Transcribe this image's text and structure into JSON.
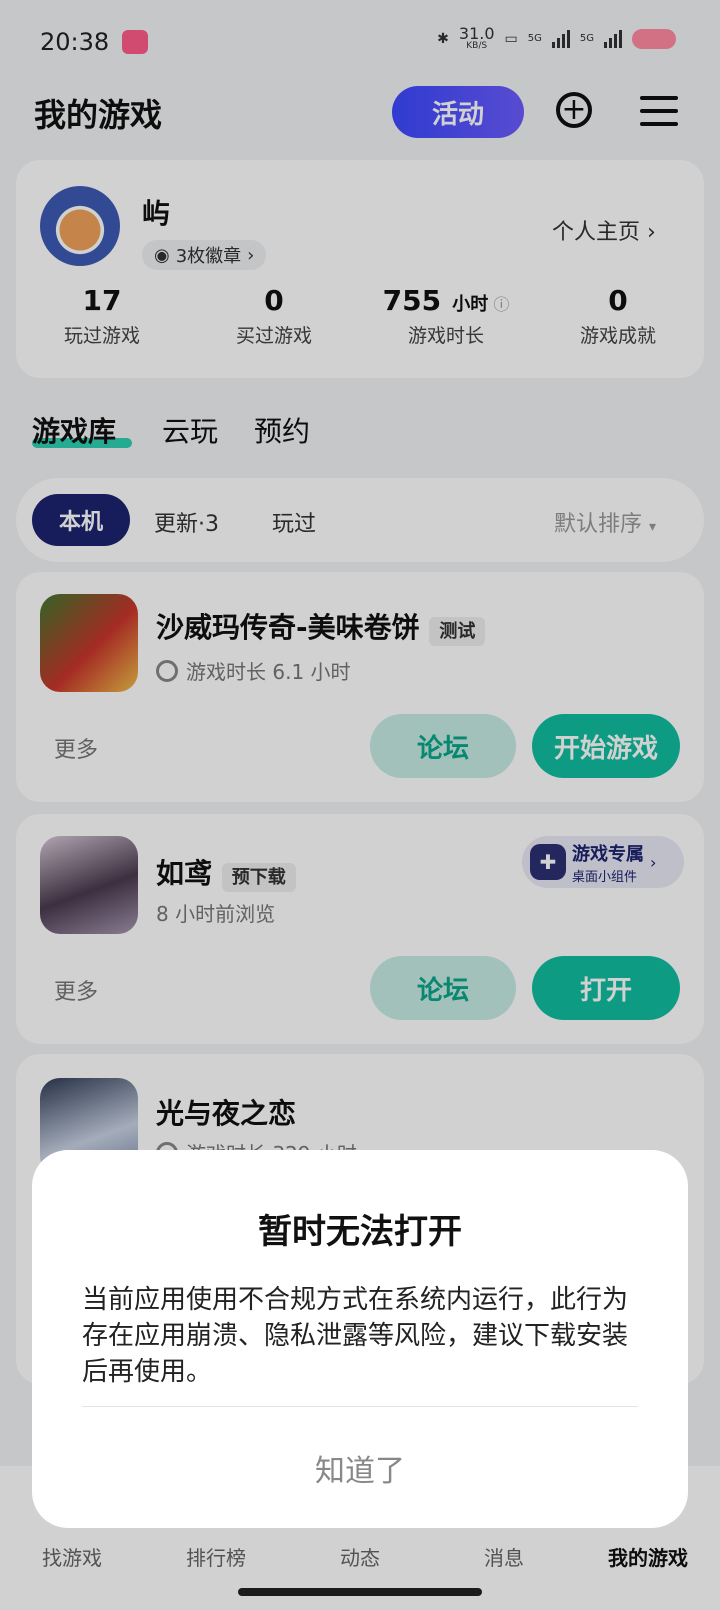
{
  "status_bar": {
    "time": "20:38",
    "net_speed": "31.0",
    "net_unit": "KB/S",
    "sim1_label": "5G",
    "sim2_label": "5G"
  },
  "header": {
    "title": "我的游戏",
    "activity_label": "活动"
  },
  "profile": {
    "name": "屿",
    "badges_label": "3枚徽章",
    "profile_link": "个人主页",
    "stats": [
      {
        "value": "17",
        "unit": "",
        "label": "玩过游戏"
      },
      {
        "value": "0",
        "unit": "",
        "label": "买过游戏"
      },
      {
        "value": "755",
        "unit": "小时",
        "label": "游戏时长"
      },
      {
        "value": "0",
        "unit": "",
        "label": "游戏成就"
      }
    ]
  },
  "tabs": [
    "游戏库",
    "云玩",
    "预约"
  ],
  "filters": {
    "chips": [
      "本机",
      "更新·3",
      "玩过"
    ],
    "sort": "默认排序"
  },
  "games": [
    {
      "title": "沙威玛传奇-美味卷饼",
      "tag": "测试",
      "subtitle": "游戏时长 6.1 小时",
      "more": "更多",
      "forum": "论坛",
      "action": "开始游戏"
    },
    {
      "title": "如鸢",
      "tag": "预下载",
      "subtitle": "8 小时前浏览",
      "more": "更多",
      "forum": "论坛",
      "action": "打开",
      "widget": {
        "line1": "游戏专属",
        "line2": "桌面小组件"
      }
    },
    {
      "title": "光与夜之恋",
      "subtitle": "游戏时长 329 小时"
    }
  ],
  "bottom_nav": [
    "找游戏",
    "排行榜",
    "动态",
    "消息",
    "我的游戏"
  ],
  "dialog": {
    "title": "暂时无法打开",
    "body": "当前应用使用不合规方式在系统内运行，此行为存在应用崩溃、隐私泄露等风险，建议下载安装后再使用。",
    "button": "知道了"
  }
}
